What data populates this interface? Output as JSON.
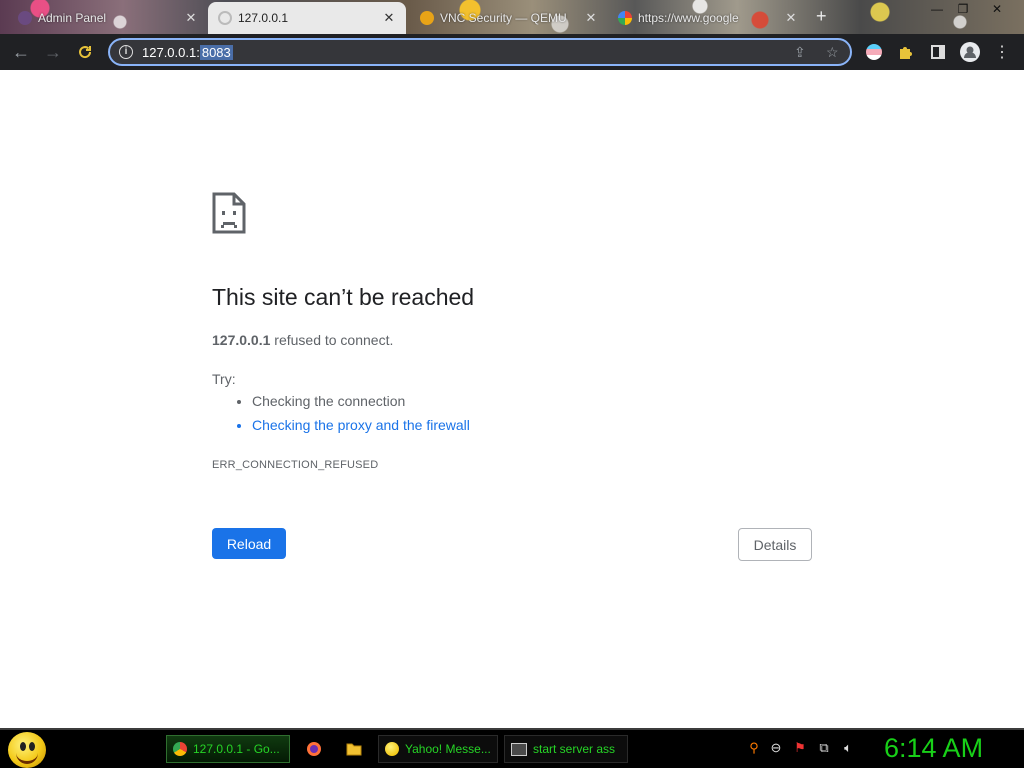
{
  "browser": {
    "tabs": [
      {
        "title": "Admin Panel",
        "active": false
      },
      {
        "title": "127.0.0.1",
        "active": true
      },
      {
        "title": "VNC Security — QEMU",
        "active": false
      },
      {
        "title": "https://www.google",
        "active": false
      }
    ],
    "new_tab_symbol": "+",
    "omnibox": {
      "url_host": "127.0.0.1",
      "url_rest": ":8083",
      "selected_text": "8083"
    }
  },
  "error_page": {
    "title": "This site can’t be reached",
    "host": "127.0.0.1",
    "message_tail": " refused to connect.",
    "try_label": "Try:",
    "suggestions": [
      {
        "text": "Checking the connection",
        "link": false
      },
      {
        "text": "Checking the proxy and the firewall",
        "link": true
      }
    ],
    "error_code": "ERR_CONNECTION_REFUSED",
    "reload_label": "Reload",
    "details_label": "Details"
  },
  "taskbar": {
    "tasks": [
      {
        "title": "127.0.0.1 - Go...",
        "icon": "chrome-icon",
        "active": true
      },
      {
        "title": "Yahoo! Messe...",
        "icon": "yahoo-messenger-icon",
        "active": false
      },
      {
        "title": "start server ass",
        "icon": "window-icon",
        "active": false
      }
    ],
    "clock": "6:14 AM"
  },
  "colors": {
    "link_blue": "#1a73e8",
    "taskbar_green": "#26d426",
    "toolbar_bg": "#202124"
  }
}
